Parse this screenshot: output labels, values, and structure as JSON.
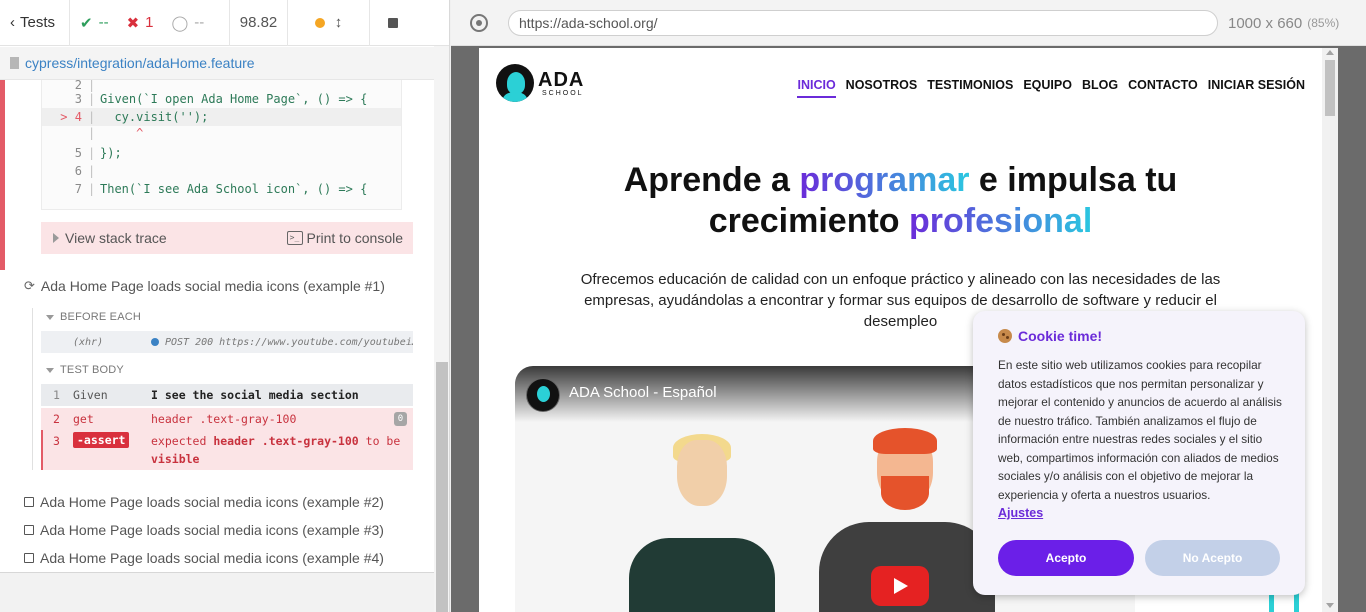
{
  "reporter": {
    "tests_label": "Tests",
    "passed": "--",
    "failed": "1",
    "pending": "--",
    "duration": "98.82",
    "spec_path": "cypress/integration/adaHome.feature"
  },
  "code_frame": {
    "lines": [
      {
        "num": "2",
        "marker": "",
        "code": ""
      },
      {
        "num": "3",
        "marker": "",
        "code": "Given(`I open Ada Home Page`, () => {"
      },
      {
        "num": "4",
        "marker": ">",
        "code": "  cy.visit('');"
      },
      {
        "num": "",
        "marker": "",
        "code": "     ^"
      },
      {
        "num": "5",
        "marker": "",
        "code": "});"
      },
      {
        "num": "6",
        "marker": "",
        "code": ""
      },
      {
        "num": "7",
        "marker": "",
        "code": "Then(`I see Ada School icon`, () => {"
      }
    ],
    "view_stack_trace": "View stack trace",
    "print_to_console": "Print to console"
  },
  "tests": {
    "current_title": "Ada Home Page loads social media icons (example #1)",
    "before_each": "BEFORE EACH",
    "xhr_name": "(xhr)",
    "xhr_msg": "POST 200 https://www.youtube.com/youtubei…",
    "test_body": "TEST BODY",
    "commands": [
      {
        "num": "1",
        "name": "Given",
        "msg": "I see the social media section"
      },
      {
        "num": "2",
        "name": "get",
        "msg": "header .text-gray-100",
        "badge": "0"
      },
      {
        "num": "3",
        "name": "-assert",
        "msg_prefix": "expected ",
        "msg_selector": "header .text-gray-100",
        "msg_suffix": " to be",
        "msg_last": "visible"
      }
    ],
    "other_titles": [
      "Ada Home Page loads social media icons (example #2)",
      "Ada Home Page loads social media icons (example #3)",
      "Ada Home Page loads social media icons (example #4)"
    ]
  },
  "aut": {
    "url": "https://ada-school.org/",
    "viewport": "1000 x 660",
    "scale": "(85%)"
  },
  "site": {
    "logo_big": "ADA",
    "logo_small": "SCHOOL",
    "nav": [
      "INICIO",
      "NOSOTROS",
      "TESTIMONIOS",
      "EQUIPO",
      "BLOG",
      "CONTACTO",
      "INICIAR SESIÓN"
    ],
    "hero": {
      "part1": "Aprende a ",
      "grad1": "programar",
      "part2": " e impulsa tu",
      "part3": "crecimiento ",
      "grad2": "profesional"
    },
    "subtitle": "Ofrecemos educación de calidad con un enfoque práctico y alineado con las necesidades de las empresas, ayudándolas a encontrar y formar sus equipos de desarrollo de software y reducir el desempleo",
    "video_title": "ADA School - Español"
  },
  "cookie": {
    "title": "Cookie time!",
    "body": "En este sitio web utilizamos cookies para recopilar datos estadísticos que nos permitan personalizar y mejorar el contenido y anuncios de acuerdo al análisis de nuestro tráfico. También analizamos el flujo de información entre nuestras redes sociales y el sitio web, compartimos información con aliados de medios sociales y/o análisis con el objetivo de mejorar la experiencia y oferta a nuestros usuarios.",
    "settings_link": "Ajustes",
    "accept": "Acepto",
    "reject": "No Acepto"
  },
  "colors": {
    "accent": "#6b2bd9",
    "teal": "#2bc7e0",
    "fail": "#d9303d",
    "pass": "#2e9e5c"
  }
}
